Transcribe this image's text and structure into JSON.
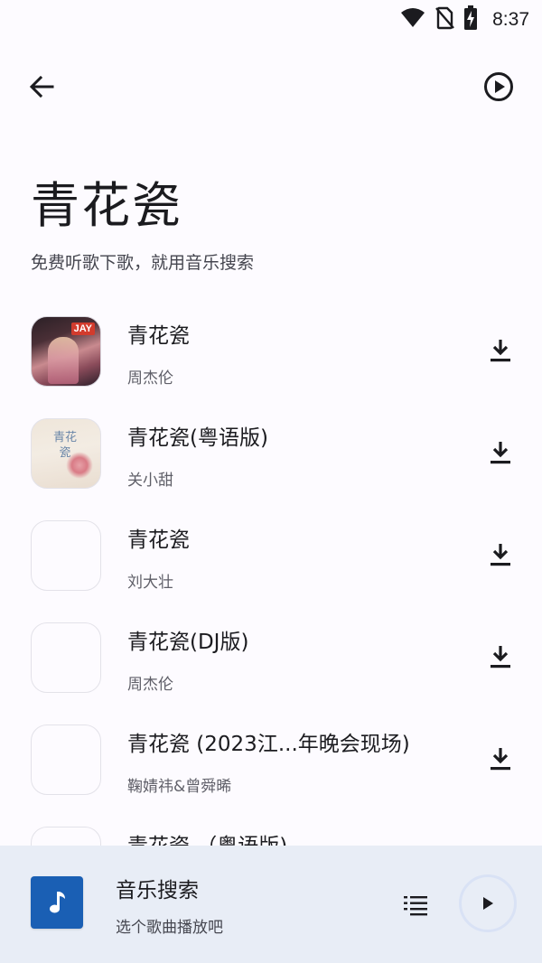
{
  "status_bar": {
    "time": "8:37",
    "icons": [
      "wifi-icon",
      "no-sim-icon",
      "battery-charging-icon"
    ]
  },
  "top_bar": {
    "back_icon": "arrow-left-icon",
    "play_icon": "play-circle-icon"
  },
  "header": {
    "title": "青花瓷",
    "subtitle": "免费听歌下歌，就用音乐搜索"
  },
  "songs": [
    {
      "title": "青花瓷",
      "artist": "周杰伦"
    },
    {
      "title": "青花瓷(粤语版)",
      "artist": "关小甜"
    },
    {
      "title": "青花瓷",
      "artist": "刘大壮"
    },
    {
      "title": "青花瓷(DJ版)",
      "artist": "周杰伦"
    },
    {
      "title": "青花瓷 (2023江...年晚会现场)",
      "artist": "鞠婧祎&曾舜晞"
    },
    {
      "title": "青花瓷 （粤语版)",
      "artist": ""
    }
  ],
  "cover_art": {
    "badge": "JAY",
    "calligraphy": "青花瓷"
  },
  "player": {
    "title": "音乐搜索",
    "subtitle": "选个歌曲播放吧",
    "cover_icon": "music-note-icon",
    "accent_color": "#1a5fb4"
  },
  "colors": {
    "background": "#fdfbff",
    "player_background": "#e8edf6",
    "accent": "#1a5fb4"
  }
}
